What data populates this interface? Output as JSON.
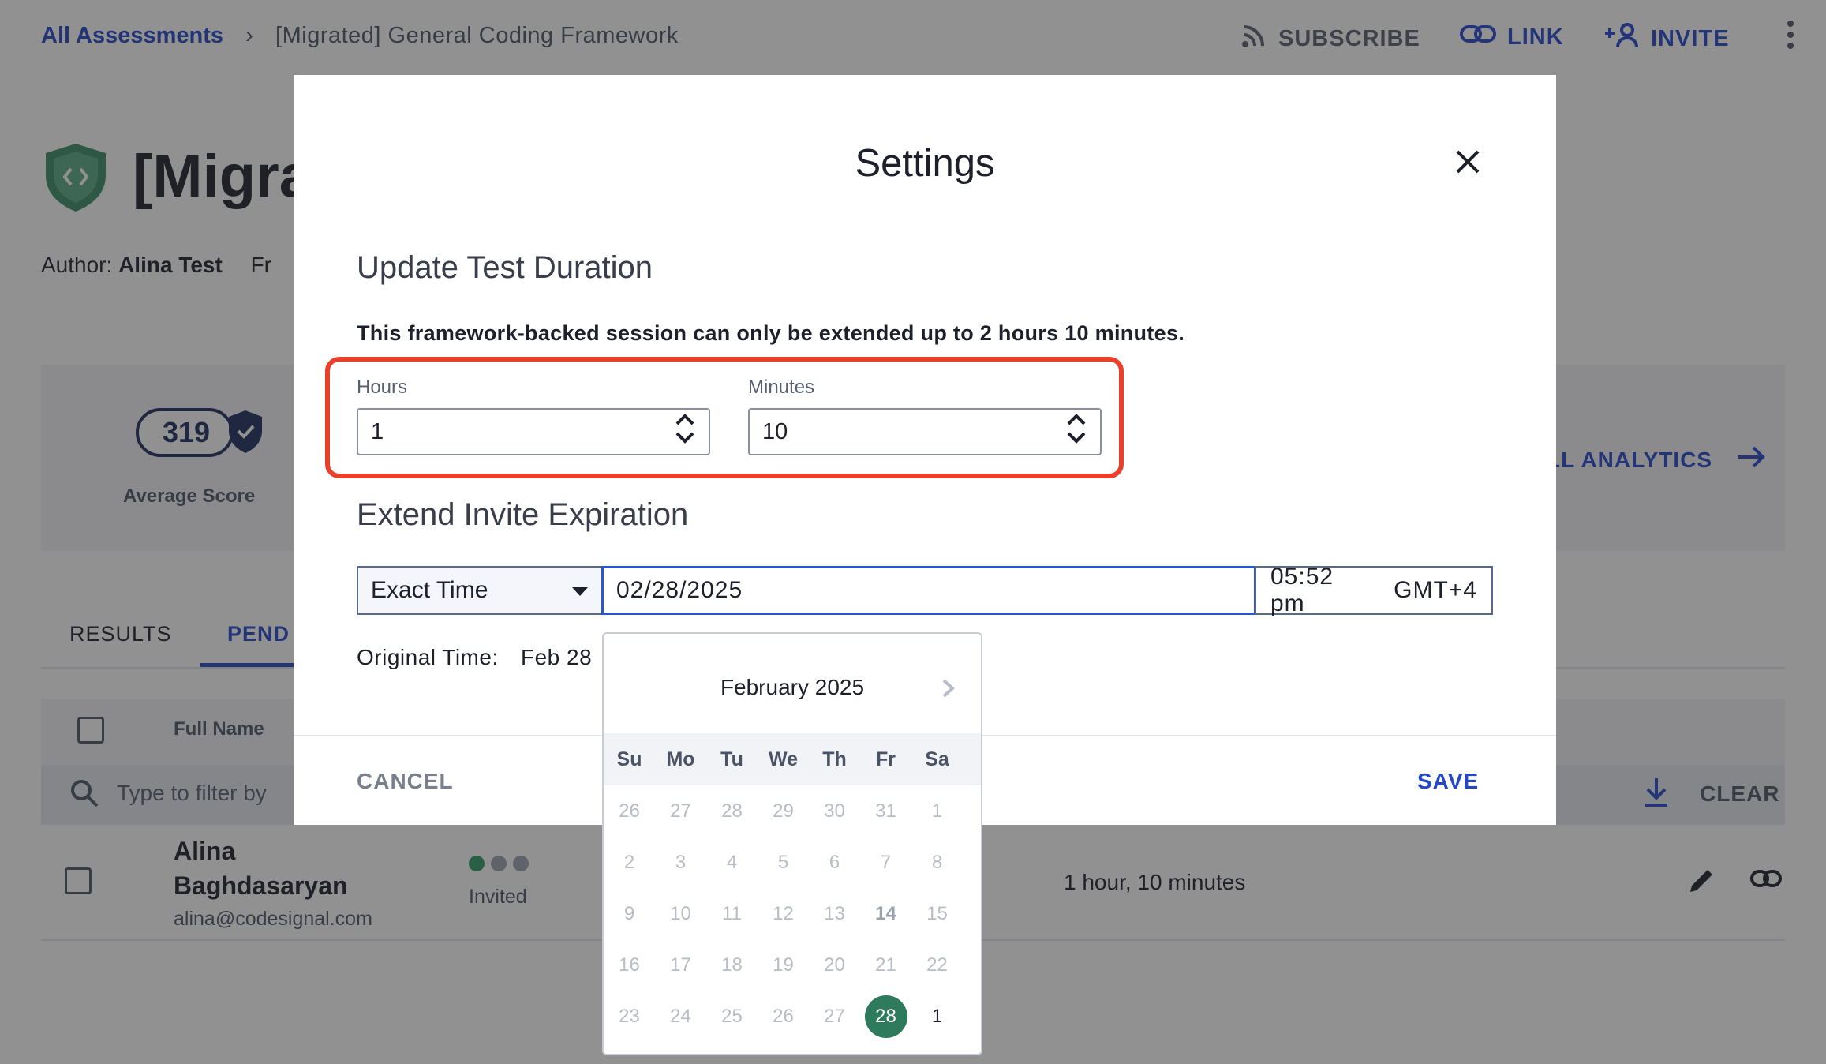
{
  "topbar": {
    "breadcrumb_root": "All Assessments",
    "breadcrumb_current": "[Migrated] General Coding Framework",
    "subscribe_label": "SUBSCRIBE",
    "link_label": "LINK",
    "invite_label": "INVITE"
  },
  "page": {
    "title": "[Migra",
    "author_label": "Author:",
    "author_name": "Alina Test",
    "author_extra": "Fr",
    "score_value": "319",
    "score_label": "Average Score",
    "analytics_label": "LL ANALYTICS"
  },
  "tabs": [
    {
      "label": "RESULTS"
    },
    {
      "label": "PEND"
    }
  ],
  "table": {
    "header_full_name": "Full Name",
    "filter_placeholder": "Type to filter by",
    "clear_label": "CLEAR",
    "row": {
      "name_line1": "Alina",
      "name_line2": "Baghdasaryan",
      "email": "alina@codesignal.com",
      "status": "Invited",
      "duration": "1 hour, 10 minutes"
    }
  },
  "modal": {
    "title": "Settings",
    "duration_heading": "Update Test Duration",
    "duration_note": "This framework-backed session can only be extended up to 2 hours 10 minutes.",
    "hours_label": "Hours",
    "hours_value": "1",
    "minutes_label": "Minutes",
    "minutes_value": "10",
    "expiration_heading": "Extend Invite Expiration",
    "mode_value": "Exact Time",
    "date_value": "02/28/2025",
    "time_value": "05:52 pm",
    "timezone_value": "GMT+4",
    "original_time_label": "Original Time:",
    "original_time_value": "Feb 28",
    "cancel_label": "CANCEL",
    "save_label": "SAVE"
  },
  "calendar": {
    "month_label": "February 2025",
    "weekdays": [
      "Su",
      "Mo",
      "Tu",
      "We",
      "Th",
      "Fr",
      "Sa"
    ],
    "weeks": [
      [
        "26",
        "27",
        "28",
        "29",
        "30",
        "31",
        "1"
      ],
      [
        "2",
        "3",
        "4",
        "5",
        "6",
        "7",
        "8"
      ],
      [
        "9",
        "10",
        "11",
        "12",
        "13",
        "14",
        "15"
      ],
      [
        "16",
        "17",
        "18",
        "19",
        "20",
        "21",
        "22"
      ],
      [
        "23",
        "24",
        "25",
        "26",
        "27",
        "28",
        "1"
      ]
    ],
    "selected_day": "28",
    "today_day": "14"
  },
  "colors": {
    "accent": "#2247c8",
    "highlight_border": "#e8402a",
    "selected_day": "#2e7a5c",
    "status_green": "#2e9a66"
  }
}
